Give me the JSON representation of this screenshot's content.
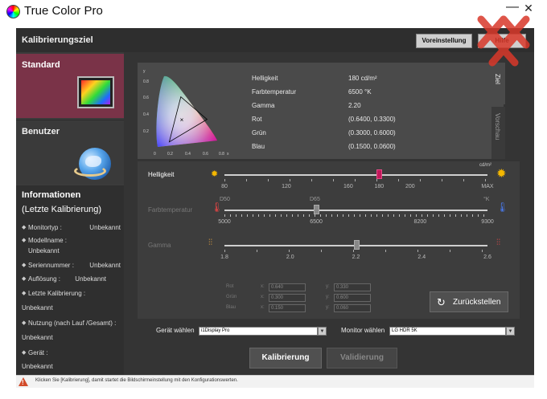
{
  "window": {
    "title": "True Color Pro",
    "minimize": "—",
    "close": "✕"
  },
  "sidebar": {
    "header": "Kalibrierungsziel",
    "modes": [
      {
        "label": "Standard"
      },
      {
        "label": "Benutzer"
      }
    ],
    "info": {
      "title": "Informationen",
      "subtitle": "(Letzte Kalibrierung)",
      "rows": [
        {
          "key": "Monitortyp :",
          "value": "Unbekannt"
        },
        {
          "key": "Modellname :",
          "value": "Unbekannt"
        },
        {
          "key": "Seriennummer :",
          "value": "Unbekannt"
        },
        {
          "key": "Auflösung :",
          "value": "Unbekannt"
        },
        {
          "key": "Letzte Kalibrierung :",
          "value": "Unbekannt"
        },
        {
          "key": "Nutzung (nach Lauf /Gesamt) :",
          "value": "Unbekannt"
        },
        {
          "key": "Gerät :",
          "value": "Unbekannt"
        }
      ]
    }
  },
  "toolbar": {
    "preset": "Voreinstellung",
    "help": "Hilfe"
  },
  "target": {
    "props": [
      {
        "label": "Helligkeit",
        "value": "180 cd/m²"
      },
      {
        "label": "Farbtemperatur",
        "value": "6500 °K"
      },
      {
        "label": "Gamma",
        "value": "2.20"
      },
      {
        "label": "Rot",
        "value": "(0.6400, 0.3300)"
      },
      {
        "label": "Grün",
        "value": "(0.3000, 0.6000)"
      },
      {
        "label": "Blau",
        "value": "(0.1500, 0.0600)"
      }
    ],
    "tabs": {
      "ziel": "Ziel",
      "vorschau": "Vorschau"
    },
    "cie": {
      "y_axis_label": "y",
      "x_axis_label": "x",
      "y_ticks": [
        "0.8",
        "0.6",
        "0.4",
        "0.2"
      ],
      "x_ticks": [
        "0",
        "0.2",
        "0.4",
        "0.6",
        "0.8"
      ],
      "primaries": [
        [
          0.64,
          0.33
        ],
        [
          0.3,
          0.6
        ],
        [
          0.15,
          0.06
        ]
      ],
      "white_point": [
        0.3127,
        0.329
      ]
    }
  },
  "sliders": {
    "brightness": {
      "label": "Helligkeit",
      "unit": "cd/m²",
      "ticks": [
        "80",
        "120",
        "160",
        "180",
        "200",
        "MAX"
      ],
      "value": 180
    },
    "temperature": {
      "label": "Farbtemperatur",
      "top_marks": [
        "D50",
        "D65",
        "°K"
      ],
      "ticks": [
        "5000",
        "6500",
        "8200",
        "9300"
      ],
      "value": 6500
    },
    "gamma": {
      "label": "Gamma",
      "ticks": [
        "1.8",
        "2.0",
        "2.2",
        "2.4",
        "2.6"
      ],
      "value": 2.2
    }
  },
  "primaries_edit": {
    "rows": [
      {
        "label": "Rot",
        "x": "0.640",
        "y": "0.330"
      },
      {
        "label": "Grün",
        "x": "0.300",
        "y": "0.600"
      },
      {
        "label": "Blau",
        "x": "0.150",
        "y": "0.060"
      }
    ],
    "x_label": "x:",
    "y_label": "y:"
  },
  "reset": {
    "label": "Zurückstellen"
  },
  "device": {
    "label": "Gerät wählen",
    "value": "i1Display Pro",
    "monitor_label": "Monitor wählen",
    "monitor_value": "LG HDR 5K"
  },
  "actions": {
    "calibrate": "Kalibrierung",
    "validate": "Validierung"
  },
  "status": {
    "text": "Klicken Sie [Kalibrierung], damit startet die Bildschirmeinstellung mit den Konfigurationswerten."
  }
}
